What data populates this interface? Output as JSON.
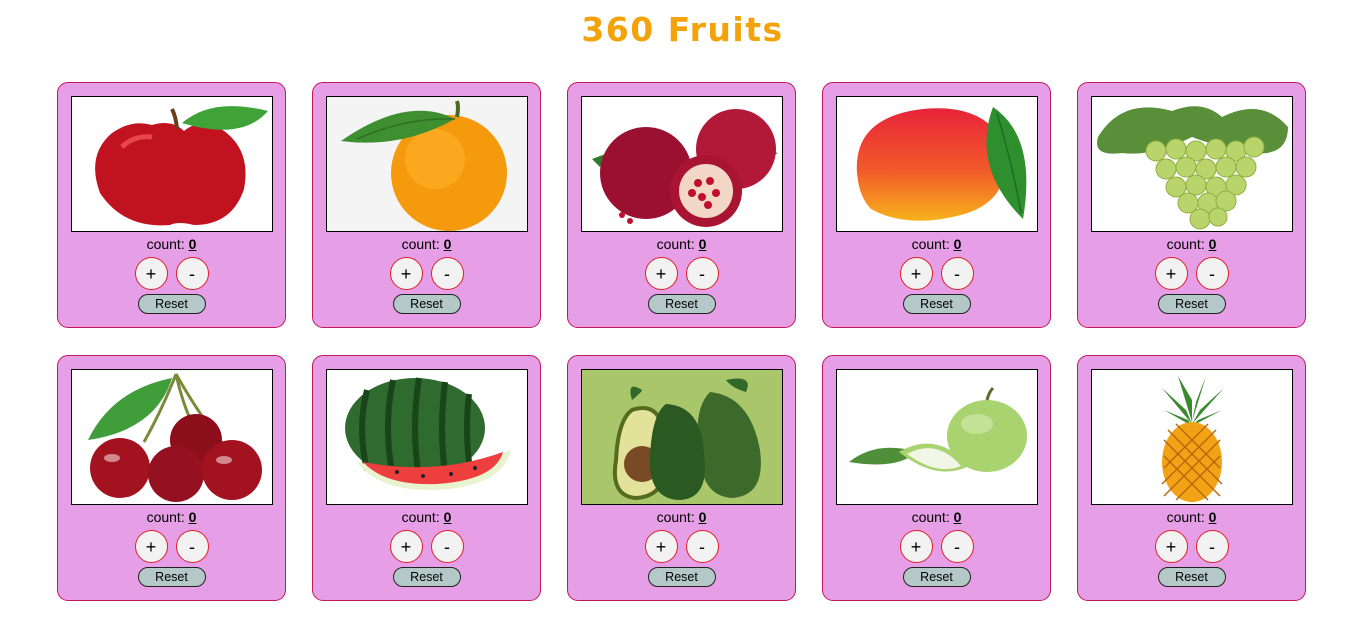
{
  "header": {
    "title": "360 Fruits"
  },
  "labels": {
    "count": "count:",
    "increment": "+",
    "decrement": "-",
    "reset": "Reset"
  },
  "cards": [
    {
      "fruit": "apple",
      "count": "0"
    },
    {
      "fruit": "orange",
      "count": "0"
    },
    {
      "fruit": "pomegranate",
      "count": "0"
    },
    {
      "fruit": "mango",
      "count": "0"
    },
    {
      "fruit": "grapes",
      "count": "0"
    },
    {
      "fruit": "cherries",
      "count": "0"
    },
    {
      "fruit": "watermelon",
      "count": "0"
    },
    {
      "fruit": "avocado",
      "count": "0"
    },
    {
      "fruit": "guava",
      "count": "0"
    },
    {
      "fruit": "pineapple",
      "count": "0"
    }
  ],
  "colors": {
    "title": "#f4a20a",
    "card_bg": "#e69ee6",
    "card_border": "#c2185b",
    "circle_border": "#e0202a",
    "reset_bg": "#b4c9c7"
  }
}
